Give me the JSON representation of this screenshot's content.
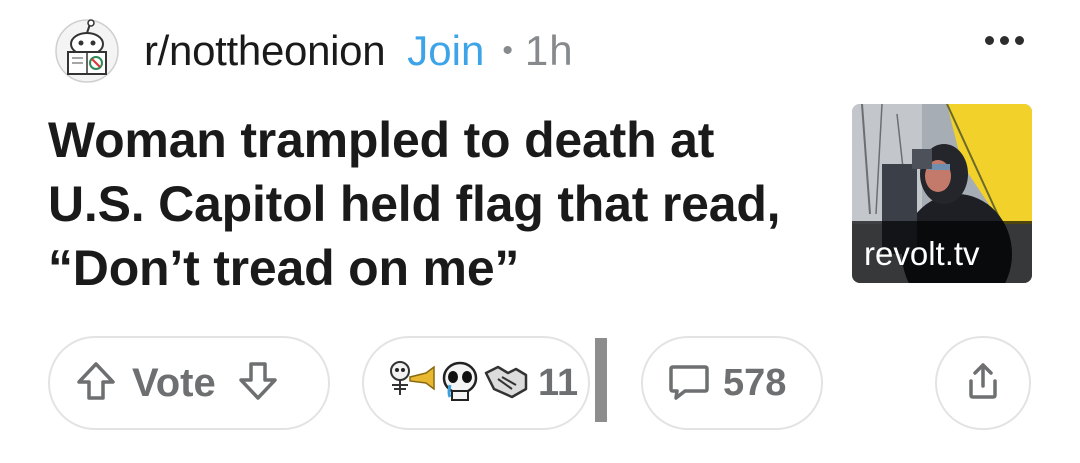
{
  "header": {
    "subreddit": "r/nottheonion",
    "join_label": "Join",
    "separator": "•",
    "time": "1h"
  },
  "post": {
    "title": "Woman trampled to death at U.S. Capitol held flag that read, “Don’t tread on me”",
    "thumbnail_domain": "revolt.tv"
  },
  "actions": {
    "vote_label": "Vote",
    "award_count": "11",
    "comment_count": "578"
  },
  "colors": {
    "join": "#3da4e8",
    "muted": "#878a8c",
    "border": "#e3e3e3"
  },
  "icons": [
    "snoo-avatar-icon",
    "more-options-icon",
    "upvote-arrow-icon",
    "downvote-arrow-icon",
    "skull-trumpet-award-icon",
    "crying-skull-award-icon",
    "handshake-award-icon",
    "comment-bubble-icon",
    "share-icon"
  ]
}
